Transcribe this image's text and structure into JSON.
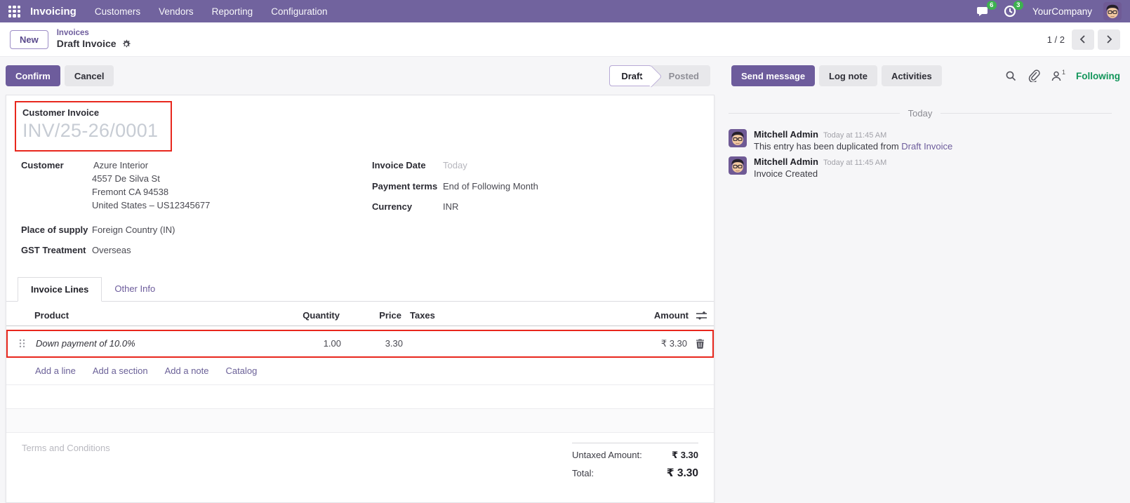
{
  "colors": {
    "primary_purple": "#6d5c9c",
    "nav_purple": "#71639e",
    "highlight_red": "#e8271d",
    "badge_green": "#3db14f",
    "following_green": "#12955a"
  },
  "nav": {
    "app_name": "Invoicing",
    "menus": [
      "Customers",
      "Vendors",
      "Reporting",
      "Configuration"
    ],
    "messages_badge": "6",
    "activities_badge": "3",
    "company": "YourCompany"
  },
  "breadcrumb": {
    "new_button": "New",
    "parent": "Invoices",
    "current": "Draft Invoice",
    "pager": "1 / 2"
  },
  "actions": {
    "confirm": "Confirm",
    "cancel": "Cancel",
    "send_message": "Send message",
    "log_note": "Log note",
    "activities": "Activities",
    "follower_count": "1",
    "following": "Following"
  },
  "statusbar": {
    "states": [
      "Draft",
      "Posted"
    ],
    "active": "Draft"
  },
  "sheet": {
    "doc_type": "Customer Invoice",
    "doc_number": "INV/25-26/0001",
    "fields": {
      "customer_label": "Customer",
      "customer_name": "Azure Interior",
      "customer_address": [
        "4557 De Silva St",
        "Fremont CA 94538",
        "United States – US12345677"
      ],
      "place_of_supply_label": "Place of supply",
      "place_of_supply": "Foreign Country (IN)",
      "gst_treatment_label": "GST Treatment",
      "gst_treatment": "Overseas",
      "invoice_date_label": "Invoice Date",
      "invoice_date_placeholder": "Today",
      "payment_terms_label": "Payment terms",
      "payment_terms": "End of Following Month",
      "currency_label": "Currency",
      "currency": "INR"
    },
    "tabs": [
      "Invoice Lines",
      "Other Info"
    ],
    "table": {
      "headers": {
        "product": "Product",
        "quantity": "Quantity",
        "price": "Price",
        "taxes": "Taxes",
        "amount": "Amount"
      },
      "rows": [
        {
          "product": "Down payment of 10.0%",
          "quantity": "1.00",
          "price": "3.30",
          "taxes": "",
          "amount": "₹ 3.30"
        }
      ],
      "links": [
        "Add a line",
        "Add a section",
        "Add a note",
        "Catalog"
      ]
    },
    "terms_placeholder": "Terms and Conditions",
    "totals": {
      "untaxed_label": "Untaxed Amount:",
      "untaxed_value": "₹ 3.30",
      "total_label": "Total:",
      "total_value": "₹ 3.30"
    }
  },
  "chatter": {
    "date_divider": "Today",
    "messages": [
      {
        "author": "Mitchell Admin",
        "time": "Today at 11:45 AM",
        "text": "This entry has been duplicated from ",
        "link": "Draft Invoice"
      },
      {
        "author": "Mitchell Admin",
        "time": "Today at 11:45 AM",
        "text": "Invoice Created",
        "link": ""
      }
    ]
  }
}
